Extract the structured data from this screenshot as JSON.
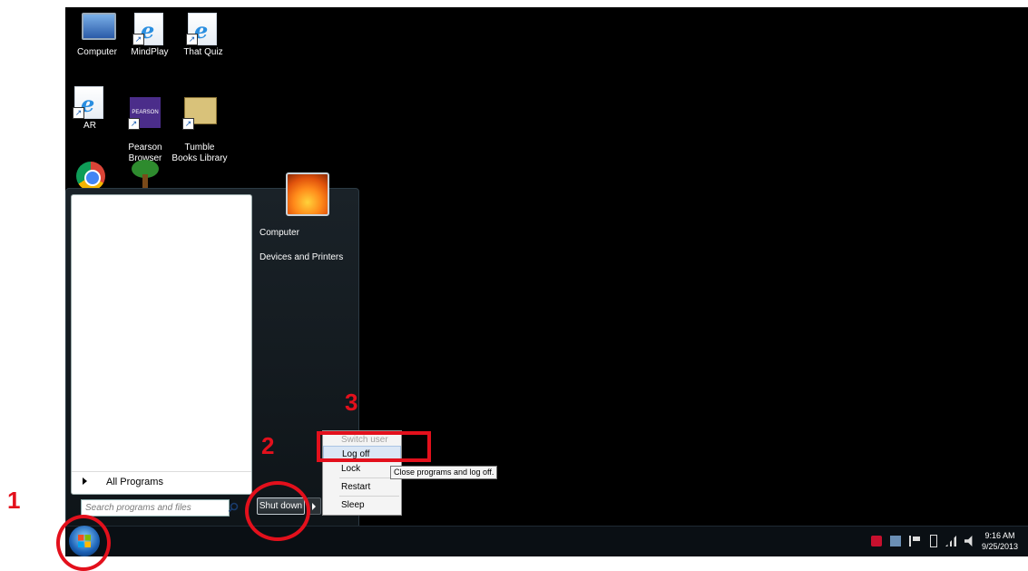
{
  "desktop": {
    "icons": [
      {
        "label": "Computer",
        "icon": "computer-icon"
      },
      {
        "label": "MindPlay",
        "icon": "internet-explorer-icon"
      },
      {
        "label": "That Quiz",
        "icon": "internet-explorer-icon"
      },
      {
        "label": "AR",
        "icon": "internet-explorer-icon"
      },
      {
        "label": "Pearson\nBrowser",
        "icon": "pearson-icon",
        "badge": "PEARSON"
      },
      {
        "label": "Tumble\nBooks Library",
        "icon": "tumble-books-icon"
      },
      {
        "label": "",
        "icon": "chrome-icon"
      },
      {
        "label": "",
        "icon": "tree-icon"
      }
    ]
  },
  "start_menu": {
    "all_programs": "All Programs",
    "search_placeholder": "Search programs and files",
    "right_items": [
      "Computer",
      "Devices and Printers"
    ],
    "shutdown_label": "Shut down"
  },
  "shutdown_submenu": {
    "items": [
      "Switch user",
      "Log off",
      "Lock",
      "Restart",
      "Sleep"
    ],
    "highlighted": "Log off",
    "disabled": "Switch user",
    "tooltip": "Close programs and log off."
  },
  "taskbar": {
    "time": "9:16 AM",
    "date": "9/25/2013",
    "tray_icons": [
      "mcafee-icon",
      "network-drive-icon",
      "action-center-flag-icon",
      "battery-icon",
      "signal-icon",
      "volume-icon"
    ]
  },
  "annotations": {
    "step1": "1",
    "step2": "2",
    "step3": "3",
    "color": "#e3101c"
  }
}
